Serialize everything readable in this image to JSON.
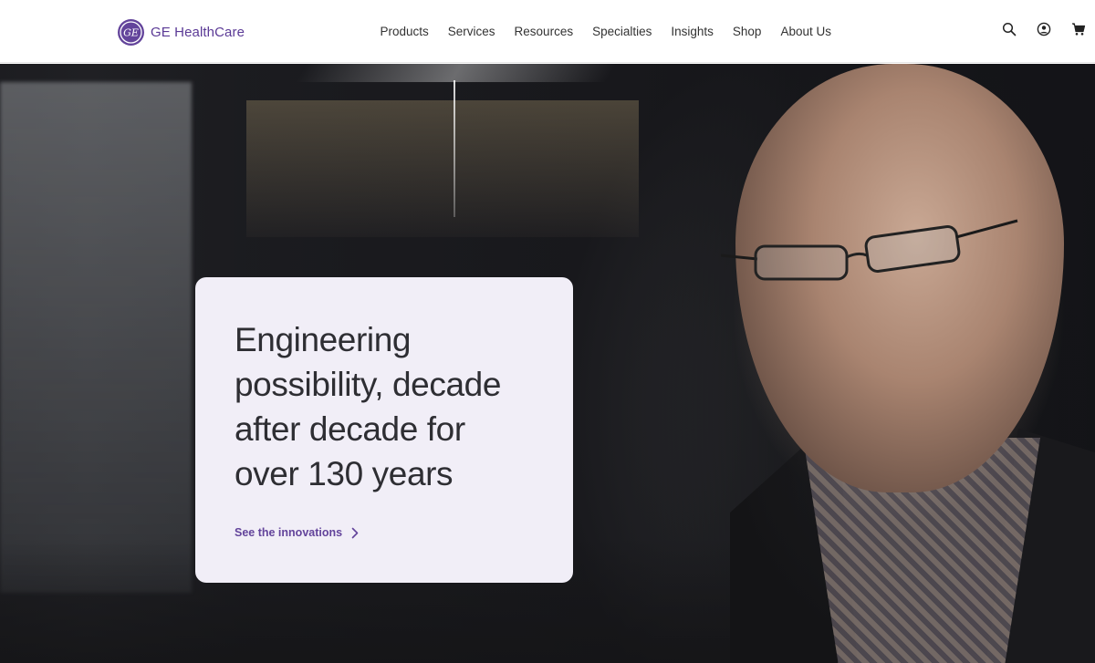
{
  "brand": {
    "name": "GE HealthCare",
    "logo_text": "GE",
    "color": "#63449b"
  },
  "nav": {
    "items": [
      {
        "label": "Products"
      },
      {
        "label": "Services"
      },
      {
        "label": "Resources"
      },
      {
        "label": "Specialties"
      },
      {
        "label": "Insights"
      },
      {
        "label": "Shop"
      },
      {
        "label": "About Us"
      }
    ]
  },
  "tools": {
    "search_icon": "search-icon",
    "account_icon": "user-icon",
    "cart_icon": "cart-icon"
  },
  "hero": {
    "headline": "Engineering possibility, decade after decade for over 130 years",
    "cta_label": "See the innovations",
    "card_color": "#f1eef7",
    "accent": "#63449b"
  }
}
